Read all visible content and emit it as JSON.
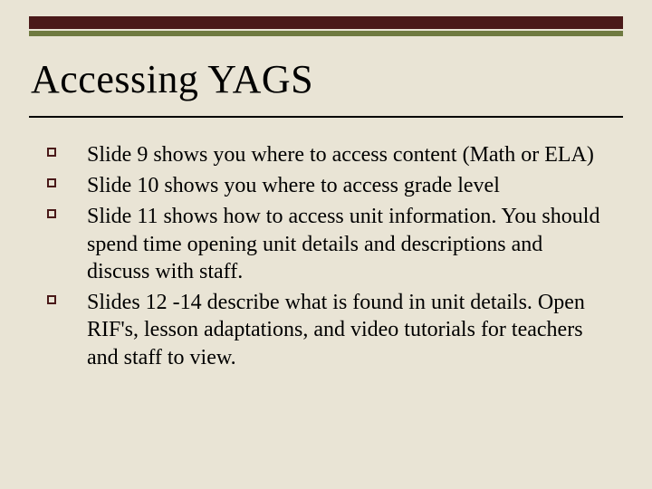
{
  "slide": {
    "title": "Accessing YAGS",
    "bullets": [
      "Slide 9 shows you where to access content (Math or ELA)",
      "Slide 10 shows you where to access grade level",
      "Slide 11 shows how to access unit information.  You should spend time opening unit details and descriptions and discuss with staff.",
      "Slides 12 -14 describe what is found in unit details.  Open RIF's, lesson adaptations, and video tutorials for teachers and staff to view."
    ]
  }
}
